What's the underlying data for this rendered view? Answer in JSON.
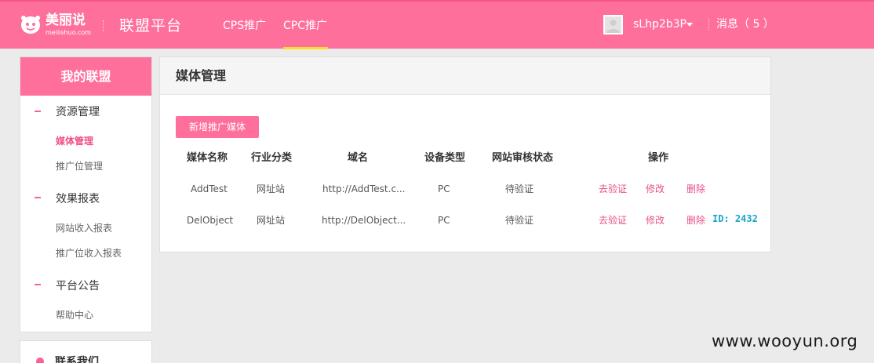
{
  "header": {
    "logo_text": "美丽说",
    "logo_sub": "meilishuo.com",
    "platform_title": "联盟平台",
    "tabs": [
      {
        "label": "CPS推广",
        "active": false
      },
      {
        "label": "CPC推广",
        "active": true
      }
    ],
    "username": "sLhp2b3P",
    "messages": "消息（ 5 ）",
    "brand_color": "#ff6f9c",
    "active_tab_underline_color": "#ffdd33"
  },
  "sidebar": {
    "title": "我的联盟",
    "groups": [
      {
        "title": "资源管理",
        "items": [
          {
            "label": "媒体管理",
            "active": true
          },
          {
            "label": "推广位管理",
            "active": false
          }
        ]
      },
      {
        "title": "效果报表",
        "items": [
          {
            "label": "网站收入报表",
            "active": false
          },
          {
            "label": "推广位收入报表",
            "active": false
          }
        ]
      },
      {
        "title": "平台公告",
        "items": [
          {
            "label": "帮助中心",
            "active": false
          }
        ]
      }
    ],
    "contact_label": "联系我们"
  },
  "main": {
    "title": "媒体管理",
    "add_button": "新增推广媒体",
    "columns": [
      "媒体名称",
      "行业分类",
      "域名",
      "设备类型",
      "网站审核状态",
      "操作"
    ],
    "rows": [
      {
        "name": "AddTest",
        "category": "网址站",
        "domain": "http://AddTest.c...",
        "device": "PC",
        "status": "待验证",
        "actions": [
          "去验证",
          "修改",
          "删除"
        ]
      },
      {
        "name": "DelObject",
        "category": "网址站",
        "domain": "http://DelObject...",
        "device": "PC",
        "status": "待验证",
        "actions": [
          "去验证",
          "修改",
          "删除"
        ]
      }
    ],
    "id_note": "ID: 2432"
  },
  "watermark": "www.wooyun.org",
  "icons": {
    "logo": "meilishuo-logo-icon",
    "avatar": "user-avatar-icon",
    "caret": "caret-down-icon",
    "group_marker": "dash-icon",
    "contact": "person-icon"
  }
}
